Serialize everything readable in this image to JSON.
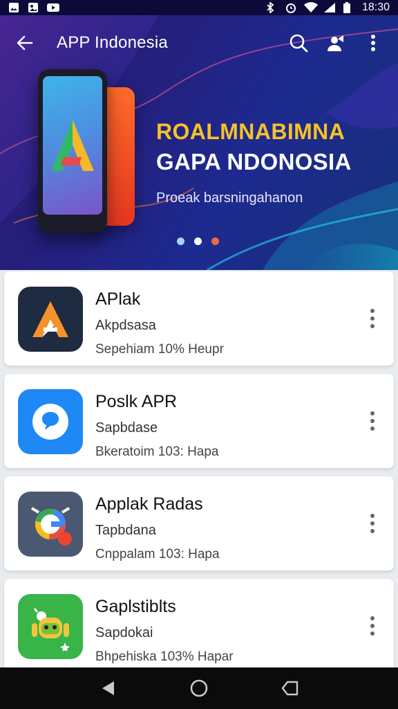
{
  "status_bar": {
    "time": "18:30",
    "icons": [
      "gallery-icon",
      "image-icon",
      "youtube-icon",
      "bluetooth-icon",
      "alarm-icon",
      "wifi-icon",
      "signal-icon",
      "battery-icon"
    ]
  },
  "app_bar": {
    "title": "APP Indonesia",
    "back_icon": "arrow-left-icon",
    "actions": [
      "search-icon",
      "share-person-icon",
      "more-vert-icon"
    ]
  },
  "banner": {
    "headline": "ROALMNABIMNA",
    "subheadline": "GAPA NDONOSIA",
    "tagline": "Proeak barsningahanon",
    "colors": {
      "headline": "#f4c228",
      "active_dot": "#f26b3a",
      "inactive_dot": "#a8d4ff"
    },
    "active_dot_index": 2,
    "dot_count": 3
  },
  "apps": [
    {
      "name": "APlak",
      "category": "Akpdsasa",
      "meta": "Sepehiam 10% Heupr",
      "icon": "a-logo-icon",
      "icon_bg": "#1f2b40"
    },
    {
      "name": "Poslk APR",
      "category": "Sapbdase",
      "meta": "Bkeratoim 103: Hapa",
      "icon": "chat-bubble-icon",
      "icon_bg": "#1e88f5"
    },
    {
      "name": "Applak Radas",
      "category": "Tapbdana",
      "meta": "Cnppalam 103: Hapa",
      "icon": "g-badge-icon",
      "icon_bg": "#4b5871"
    },
    {
      "name": "Gaplstiblts",
      "category": "Sapdokai",
      "meta": "Bhpehiska 103% Hapar",
      "icon": "android-robot-icon",
      "icon_bg": "#38b449"
    }
  ],
  "nav_bar": {
    "items": [
      "back-triangle-icon",
      "home-circle-icon",
      "recents-icon"
    ]
  }
}
